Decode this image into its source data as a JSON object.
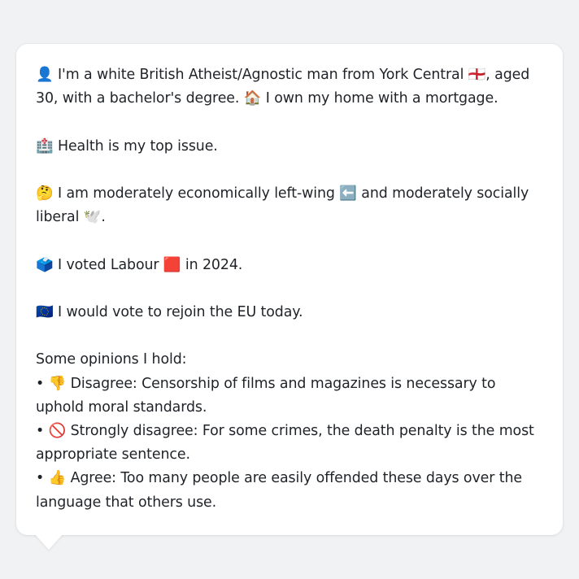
{
  "message": {
    "identity": "👤 I'm a white British Atheist/Agnostic man from York Central 🏴󠁧󠁢󠁥󠁮󠁧󠁿, aged 30, with a bachelor's degree. 🏠 I own my home with a mortgage.",
    "top_issue": "🏥 Health is my top issue.",
    "ideology": "🤔 I am moderately economically left-wing ⬅️ and moderately socially liberal 🕊️.",
    "vote": "🗳️ I voted Labour 🟥 in 2024.",
    "eu": "🇪🇺 I would vote to rejoin the EU today.",
    "opinions_heading": "Some opinions I hold:",
    "opinions": [
      "• 👎 Disagree: Censorship of films and magazines is necessary to uphold moral standards.",
      "• 🚫 Strongly disagree: For some crimes, the death penalty is the most appropriate sentence.",
      "• 👍 Agree: Too many people are easily offended these days over the language that others use."
    ]
  }
}
